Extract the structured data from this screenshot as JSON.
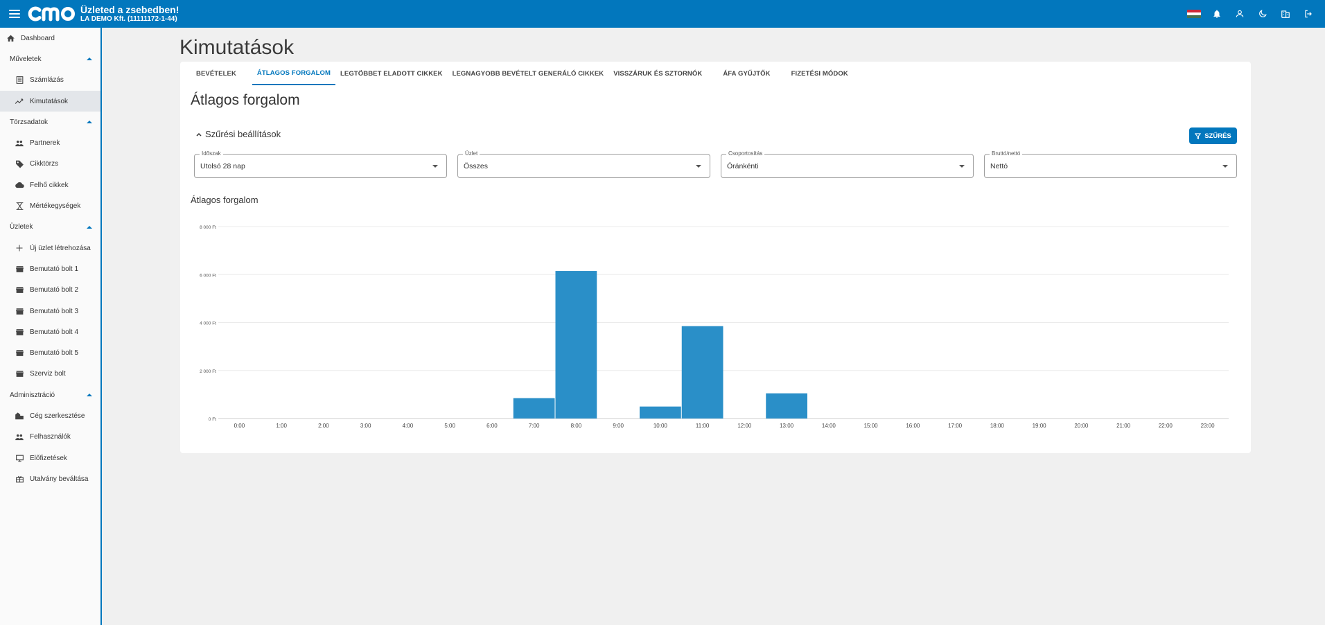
{
  "header": {
    "slogan": "Üzleted a zsebedben!",
    "company": "LA DEMO Kft. (11111172-1-44)"
  },
  "sidebar": {
    "dashboard": "Dashboard",
    "sections": [
      {
        "title": "Műveletek",
        "items": [
          "Számlázás",
          "Kimutatások"
        ]
      },
      {
        "title": "Törzsadatok",
        "items": [
          "Partnerek",
          "Cikktörzs",
          "Felhő cikkek",
          "Mértékegységek"
        ]
      },
      {
        "title": "Üzletek",
        "items": [
          "Új üzlet létrehozása",
          "Bemutató bolt 1",
          "Bemutató bolt 2",
          "Bemutató bolt 3",
          "Bemutató bolt 4",
          "Bemutató bolt 5",
          "Szerviz bolt"
        ]
      },
      {
        "title": "Adminisztráció",
        "items": [
          "Cég szerkesztése",
          "Felhasználók",
          "Előfizetések",
          "Utalvány beváltása"
        ]
      }
    ]
  },
  "page": {
    "title": "Kimutatások",
    "tabs": [
      "BEVÉTELEK",
      "ÁTLAGOS FORGALOM",
      "LEGTÖBBET ELADOTT CIKKEK",
      "LEGNAGYOBB BEVÉTELT GENERÁLÓ CIKKEK",
      "VISSZÁRUK ÉS SZTORNÓK",
      "ÁFA GYŰJTŐK",
      "FIZETÉSI MÓDOK"
    ],
    "section_title": "Átlagos forgalom",
    "filter_header": "Szűrési beállítások",
    "filter_button": "SZŰRÉS",
    "fields": [
      {
        "label": "Időszak",
        "value": "Utolsó 28 nap"
      },
      {
        "label": "Üzlet",
        "value": "Összes"
      },
      {
        "label": "Csoportosítás",
        "value": "Óránkénti"
      },
      {
        "label": "Bruttó/nettó",
        "value": "Nettó"
      }
    ],
    "chart_title": "Átlagos forgalom"
  },
  "colors": {
    "primary": "#0277bd",
    "bar": "#2a8fc8"
  },
  "chart_data": {
    "type": "bar",
    "title": "Átlagos forgalom",
    "categories": [
      "0:00",
      "1:00",
      "2:00",
      "3:00",
      "4:00",
      "5:00",
      "6:00",
      "7:00",
      "8:00",
      "9:00",
      "10:00",
      "11:00",
      "12:00",
      "13:00",
      "14:00",
      "15:00",
      "16:00",
      "17:00",
      "18:00",
      "19:00",
      "20:00",
      "21:00",
      "22:00",
      "23:00"
    ],
    "values": [
      0,
      0,
      0,
      0,
      0,
      0,
      0,
      850,
      6150,
      0,
      500,
      3850,
      0,
      1050,
      0,
      0,
      0,
      0,
      0,
      0,
      0,
      0,
      0,
      0
    ],
    "ylim": [
      0,
      8000
    ],
    "yticks": [
      {
        "value": 0,
        "label": "0 Ft"
      },
      {
        "value": 2000,
        "label": "2 000 Ft"
      },
      {
        "value": 4000,
        "label": "4 000 Ft"
      },
      {
        "value": 6000,
        "label": "6 000 Ft"
      },
      {
        "value": 8000,
        "label": "8 000 Ft"
      }
    ],
    "grid": true
  }
}
